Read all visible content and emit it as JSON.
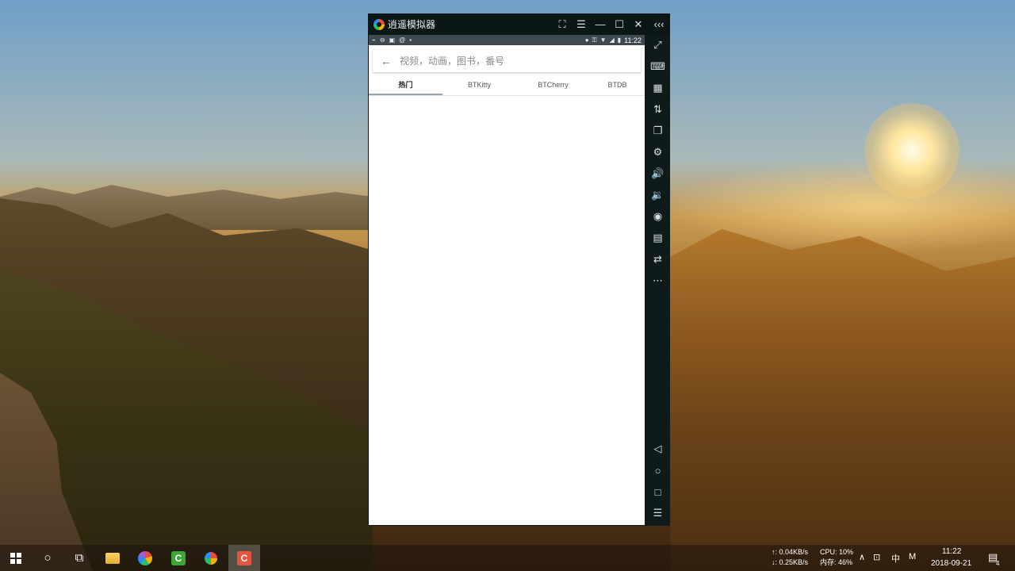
{
  "emulator": {
    "title": "逍遥模拟器",
    "title_buttons": [
      "⛶",
      "☰",
      "—",
      "☐",
      "✕",
      "‹‹‹"
    ],
    "status_bar": {
      "time": "11:22"
    },
    "search": {
      "back_icon": "←",
      "placeholder": "视频，动画，图书，番号"
    },
    "tabs": [
      {
        "label": "热门",
        "active": true
      },
      {
        "label": "BTKitty",
        "active": false
      },
      {
        "label": "BTCherry",
        "active": false
      },
      {
        "label": "BTDB",
        "active": false
      }
    ],
    "side_toolbar": [
      "expand-icon",
      "keyboard-icon",
      "screenshot-icon",
      "shake-icon",
      "multi-window-icon",
      "settings-icon",
      "volume-up-icon",
      "volume-down-icon",
      "location-icon",
      "folder-icon",
      "sync-icon",
      "more-icon",
      "back-nav-icon",
      "home-nav-icon",
      "recent-nav-icon",
      "menu-icon"
    ]
  },
  "taskbar": {
    "net_up": "↑: 0.04KB/s",
    "net_down": "↓: 0.25KB/s",
    "cpu": "CPU: 10%",
    "memory": "内存: 46%",
    "ime": "中",
    "ime_mode": "M",
    "time": "11:22",
    "date": "2018-09-21",
    "notification_count": "4"
  }
}
